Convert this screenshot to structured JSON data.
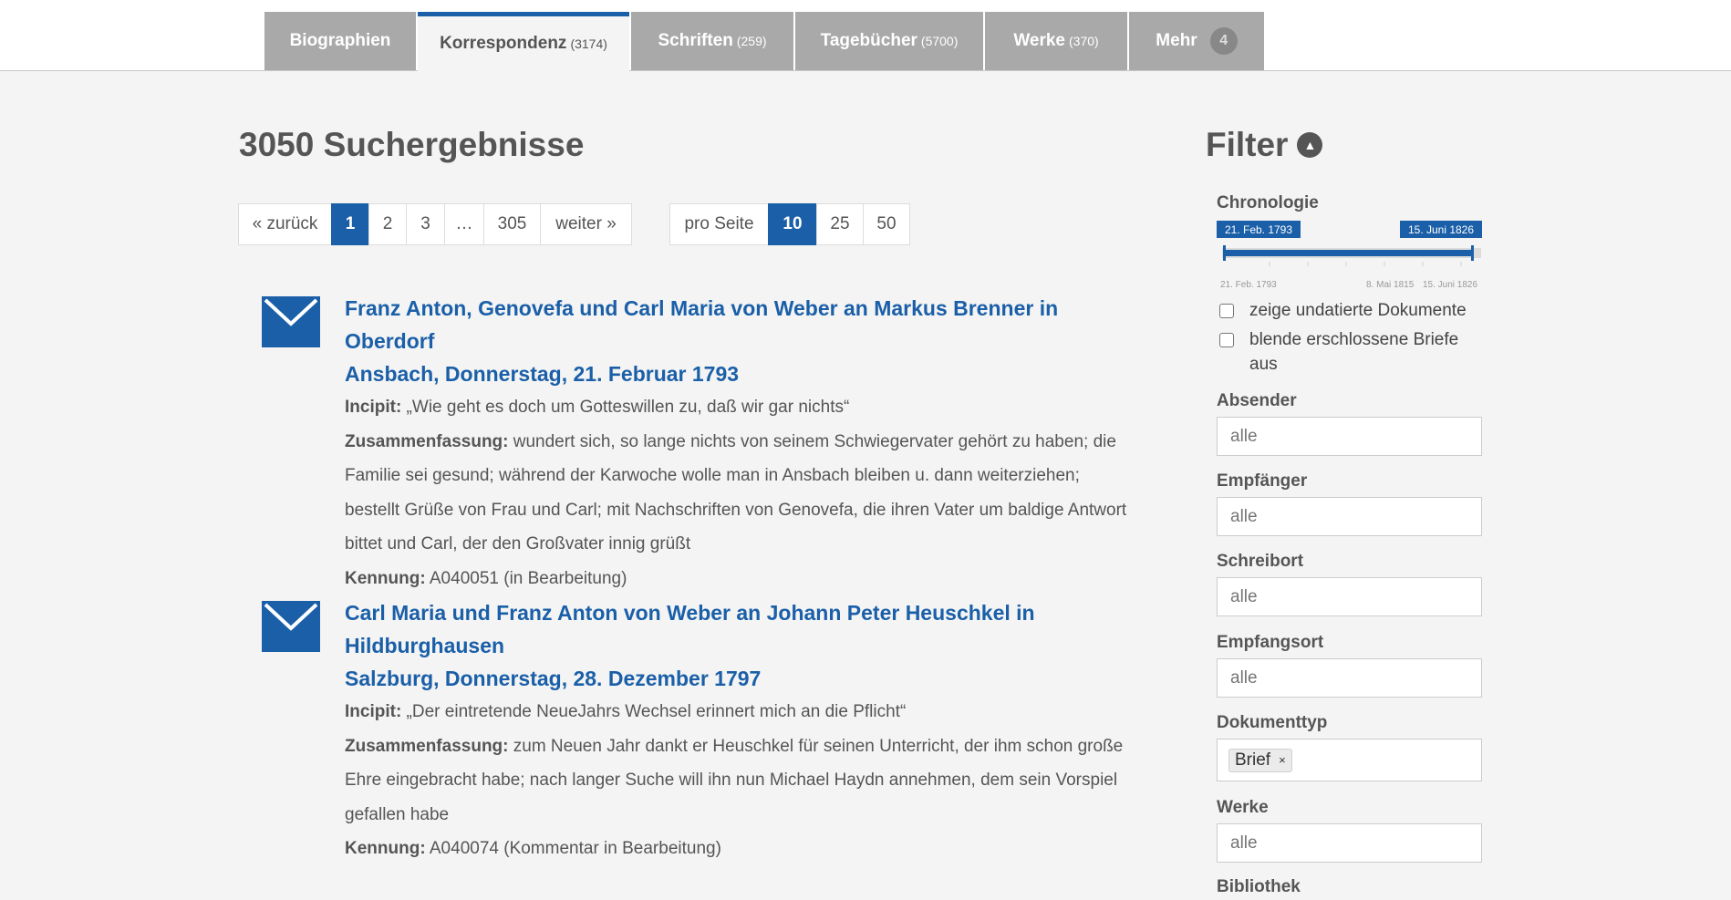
{
  "tabs": [
    {
      "label": "Biographien",
      "count": ""
    },
    {
      "label": "Korrespondenz",
      "count": "(3174)"
    },
    {
      "label": "Schriften",
      "count": "(259)"
    },
    {
      "label": "Tagebücher",
      "count": "(5700)"
    },
    {
      "label": "Werke",
      "count": "(370)"
    },
    {
      "label": "Mehr",
      "badge": "4"
    }
  ],
  "results_heading": "3050 Suchergebnisse",
  "pagination": {
    "prev": "« zurück",
    "pages": [
      "1",
      "2",
      "3",
      "…",
      "305"
    ],
    "next": "weiter »",
    "per_page_label": "pro Seite",
    "per_page_options": [
      "10",
      "25",
      "50"
    ]
  },
  "results": [
    {
      "icon": "envelope-icon",
      "title_lines": [
        "Franz Anton, Genovefa und Carl Maria von Weber an Markus Brenner in Oberdorf",
        "Ansbach, Donnerstag, 21. Februar 1793"
      ],
      "incipit_label": "Incipit:",
      "incipit": " „Wie geht es doch um Gotteswillen zu, daß wir gar nichts“",
      "summary_label": "Zusammenfassung:",
      "summary": " wundert sich, so lange nichts von seinem Schwiegervater gehört zu haben; die Familie sei gesund; während der Karwoche wolle man in Ansbach bleiben u. dann weiterziehen; bestellt Grüße von Frau und Carl; mit Nachschriften von Genovefa, die ihren Vater um baldige Antwort bittet und Carl, der den Großvater innig grüßt",
      "id_label": "Kennung:",
      "id": " A040051 (in Bearbeitung)"
    },
    {
      "icon": "envelope-icon",
      "title_lines": [
        "Carl Maria und Franz Anton von Weber an Johann Peter Heuschkel in",
        "Hildburghausen",
        "Salzburg, Donnerstag, 28. Dezember 1797"
      ],
      "incipit_label": "Incipit:",
      "incipit": " „Der eintretende NeueJahrs Wechsel erinnert mich an die Pflicht“",
      "summary_label": "Zusammenfassung:",
      "summary": " zum Neuen Jahr dankt er Heuschkel für seinen Unterricht, der ihm schon große Ehre eingebracht habe; nach langer Suche will ihn nun Michael Haydn annehmen, dem sein Vorspiel gefallen habe",
      "id_label": "Kennung:",
      "id": " A040074 (Kommentar in Bearbeitung)"
    }
  ],
  "filter": {
    "title": "Filter",
    "chronology": {
      "label": "Chronologie",
      "from": "21. Feb. 1793",
      "to": "15. Juni 1826",
      "axis_labels": [
        "21. Feb. 1793",
        "8. Mai 1815",
        "15. Juni 1826"
      ]
    },
    "checkboxes": [
      {
        "label": "zeige undatierte Dokumente",
        "checked": false
      },
      {
        "label": "blende erschlossene Briefe aus",
        "checked": false
      }
    ],
    "fields": {
      "absender": {
        "label": "Absender",
        "placeholder": "alle"
      },
      "empfaenger": {
        "label": "Empfänger",
        "placeholder": "alle"
      },
      "schreibort": {
        "label": "Schreibort",
        "placeholder": "alle"
      },
      "empfangsort": {
        "label": "Empfangsort",
        "placeholder": "alle"
      },
      "dokumenttyp": {
        "label": "Dokumenttyp",
        "tag": "Brief",
        "remove": "×"
      },
      "werke": {
        "label": "Werke",
        "placeholder": "alle"
      },
      "bibliothek": {
        "label": "Bibliothek"
      }
    }
  },
  "colors": {
    "accent": "#1a5fa8",
    "tab_bg": "#a9a9a9",
    "page_bg": "#f4f4f4"
  }
}
